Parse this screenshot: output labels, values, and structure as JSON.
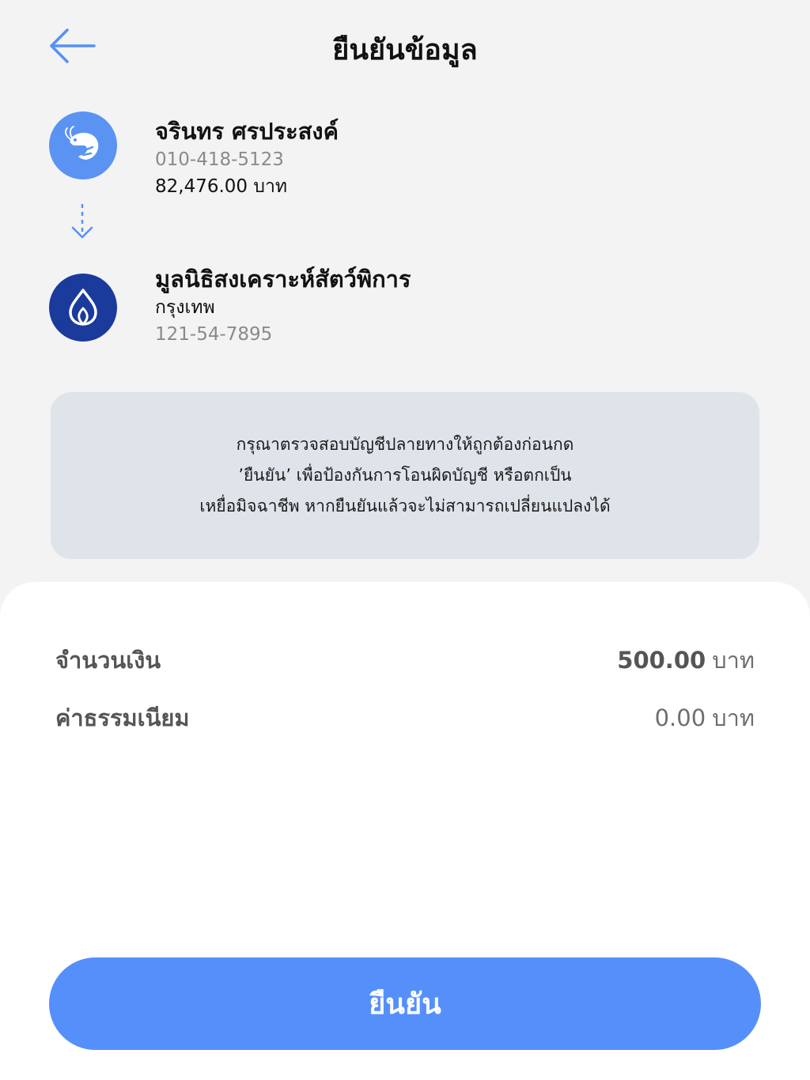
{
  "header": {
    "title": "ยืนยันข้อมูล",
    "back_icon": "arrow-left-icon"
  },
  "sender": {
    "name": "จรินทร ศรประสงค์",
    "account": "010-418-5123",
    "balance": "82,476.00 บาท",
    "avatar_icon": "shrimp-icon"
  },
  "recipient": {
    "name": "มูลนิธิสงเคราะห์สัตว์พิการ",
    "bank": "กรุงเทพ",
    "account": "121-54-7895",
    "avatar_icon": "bangkok-bank-logo-icon"
  },
  "notice": {
    "line1": "กรุณาตรวจสอบบัญชีปลายทางให้ถูกต้องก่อนกด",
    "line2": "’ยืนยัน’ เพื่อป้องกันการโอนผิดบัญชี หรือตกเป็น",
    "line3": "เหยื่อมิจฉาชีพ หากยืนยันแล้วจะไม่สามารถเปลี่ยนแปลงได้"
  },
  "summary": {
    "amount_label": "จำนวนเงิน",
    "amount_value": "500.00",
    "amount_unit": "บาท",
    "fee_label": "ค่าธรรมเนียม",
    "fee_value": "0.00",
    "fee_unit": "บาท"
  },
  "confirm_button": {
    "label": "ยืนยัน"
  },
  "colors": {
    "accent": "#5590fa",
    "bank_blue": "#1a3a9c",
    "background": "#f3f3f4",
    "notice_bg": "#dfe3ea"
  }
}
